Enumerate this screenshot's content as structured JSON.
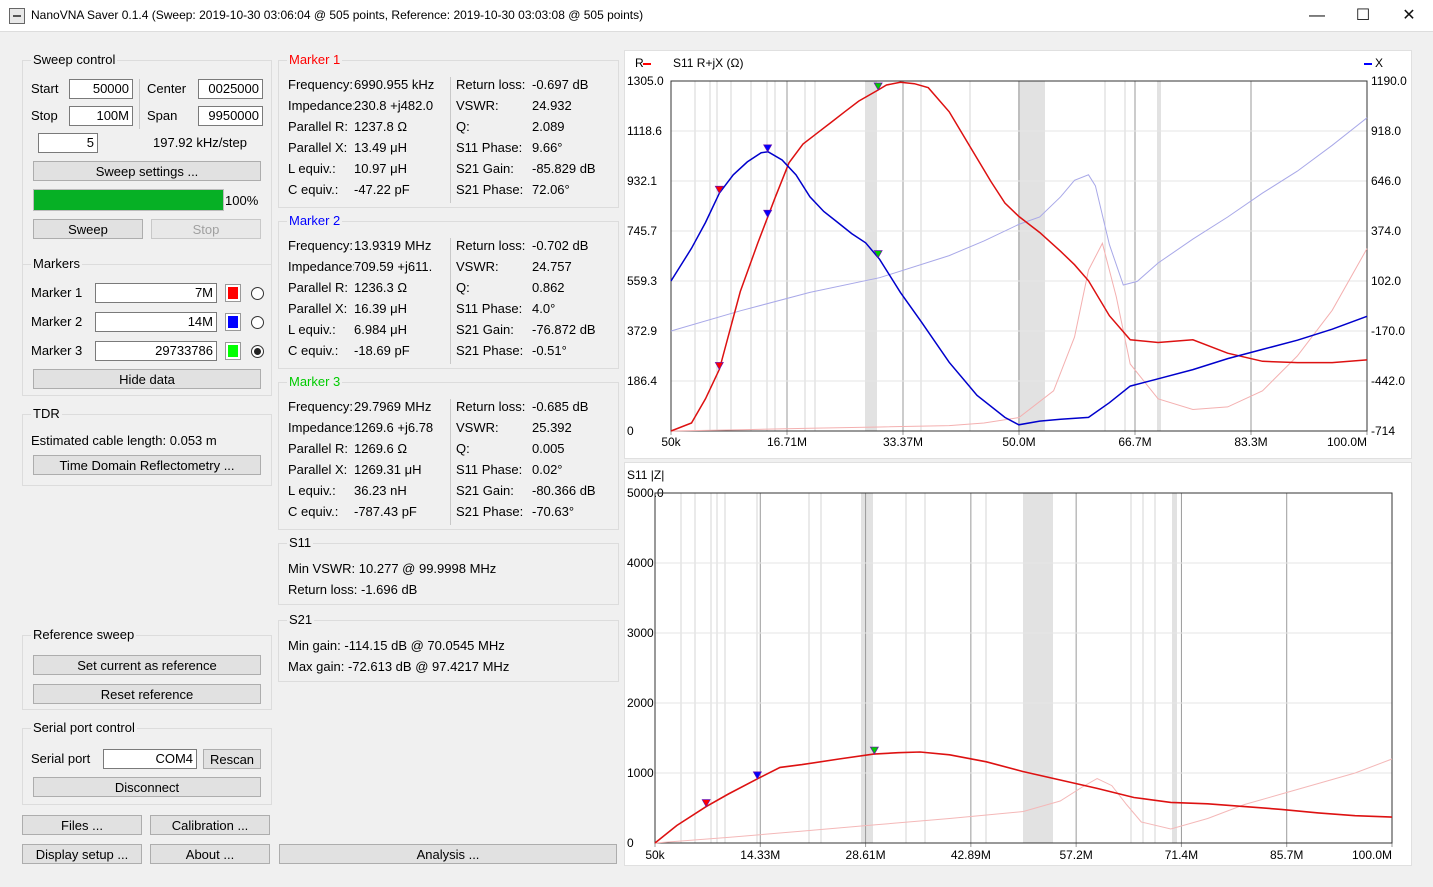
{
  "window": {
    "title": "NanoVNA Saver 0.1.4 (Sweep: 2019-10-30 03:06:04 @ 505 points, Reference: 2019-10-30 03:03:08 @ 505 points)",
    "minimize": "—",
    "maximize": "☐",
    "close": "✕"
  },
  "sweep_control": {
    "title": "Sweep control",
    "start_label": "Start",
    "start_value": "50000",
    "stop_label": "Stop",
    "stop_value": "100M",
    "center_label": "Center",
    "center_value": "0025000",
    "span_label": "Span",
    "span_value": "9950000",
    "segments_value": "5",
    "step_text": "197.92 kHz/step",
    "settings_button": "Sweep settings ...",
    "progress": 100,
    "progress_text": "100%",
    "sweep_button": "Sweep",
    "stop_button": "Stop"
  },
  "markers": {
    "title": "Markers",
    "items": [
      {
        "label": "Marker 1",
        "value": "7M",
        "color": "#ff0000",
        "selected": false
      },
      {
        "label": "Marker 2",
        "value": "14M",
        "color": "#0000ff",
        "selected": false
      },
      {
        "label": "Marker 3",
        "value": "29733786",
        "color": "#00ff00",
        "selected": true
      }
    ],
    "hide_button": "Hide data"
  },
  "tdr": {
    "title": "TDR",
    "text": "Estimated cable length: 0.053 m",
    "button": "Time Domain Reflectometry ..."
  },
  "reference": {
    "title": "Reference sweep",
    "set_button": "Set current as reference",
    "reset_button": "Reset reference"
  },
  "serial": {
    "title": "Serial port control",
    "label": "Serial port",
    "value": "COM4",
    "rescan_button": "Rescan",
    "disconnect_button": "Disconnect"
  },
  "bottom_buttons": {
    "files": "Files ...",
    "calibration": "Calibration ...",
    "display": "Display setup ...",
    "about": "About ...",
    "analysis": "Analysis ..."
  },
  "marker_data": [
    {
      "title": "Marker 1",
      "color": "#ff0000",
      "rows": [
        [
          "Frequency:",
          "6990.955 kHz",
          "Return loss:",
          "-0.697 dB"
        ],
        [
          "Impedance:",
          "230.8 +j482.0",
          "VSWR:",
          "24.932"
        ],
        [
          "Parallel R:",
          "1237.8 Ω",
          "Q:",
          "2.089"
        ],
        [
          "Parallel X:",
          "13.49 μH",
          "S11  Phase:",
          "9.66°"
        ],
        [
          "L equiv.:",
          "10.97 μH",
          "S21  Gain:",
          "-85.829 dB"
        ],
        [
          "C equiv.:",
          "-47.22 pF",
          "S21  Phase:",
          "72.06°"
        ]
      ]
    },
    {
      "title": "Marker 2",
      "color": "#0000ff",
      "rows": [
        [
          "Frequency:",
          "13.9319 MHz",
          "Return loss:",
          "-0.702 dB"
        ],
        [
          "Impedance:",
          "709.59 +j611.",
          "VSWR:",
          "24.757"
        ],
        [
          "Parallel R:",
          "1236.3 Ω",
          "Q:",
          "0.862"
        ],
        [
          "Parallel X:",
          "16.39 μH",
          "S11  Phase:",
          "4.0°"
        ],
        [
          "L equiv.:",
          "6.984 μH",
          "S21  Gain:",
          "-76.872 dB"
        ],
        [
          "C equiv.:",
          "-18.69 pF",
          "S21  Phase:",
          "-0.51°"
        ]
      ]
    },
    {
      "title": "Marker 3",
      "color": "#00cc00",
      "rows": [
        [
          "Frequency:",
          "29.7969 MHz",
          "Return loss:",
          "-0.685 dB"
        ],
        [
          "Impedance:",
          "1269.6 +j6.78",
          "VSWR:",
          "25.392"
        ],
        [
          "Parallel R:",
          "1269.6 Ω",
          "Q:",
          "0.005"
        ],
        [
          "Parallel X:",
          "1269.31 μH",
          "S11  Phase:",
          "0.02°"
        ],
        [
          "L equiv.:",
          "36.23 nH",
          "S21  Gain:",
          "-80.366 dB"
        ],
        [
          "C equiv.:",
          "-787.43 pF",
          "S21  Phase:",
          "-70.63°"
        ]
      ]
    }
  ],
  "s11": {
    "title": "S11",
    "min_vswr": "Min VSWR:   10.277 @ 99.9998 MHz",
    "return_loss": "Return loss: -1.696 dB"
  },
  "s21": {
    "title": "S21",
    "min_gain": "Min gain:  -114.15 dB @ 70.0545 MHz",
    "max_gain": "Max gain: -72.613 dB @ 97.4217 MHz"
  },
  "chart_data": [
    {
      "type": "line",
      "title": "S11  R+jX (Ω)",
      "left_legend": "R",
      "right_legend": "X",
      "xlabel": "",
      "ylabel": "",
      "x_tick_labels": [
        "50k",
        "16.71M",
        "33.37M",
        "50.0M",
        "66.7M",
        "83.3M",
        "100.0M"
      ],
      "y_left_tick_labels": [
        "1305.0",
        "1118.6",
        "932.1",
        "745.7",
        "559.3",
        "372.9",
        "186.4",
        "0"
      ],
      "y_right_tick_labels": [
        "1190.0",
        "918.0",
        "646.0",
        "374.0",
        "102.0",
        "-170.0",
        "-442.0",
        "-714"
      ],
      "xlim": [
        0.05,
        100
      ],
      "ylim_left": [
        0,
        1305
      ],
      "ylim_right": [
        -714,
        1190
      ],
      "grid": true,
      "series": [
        {
          "name": "R",
          "color": "#dd1111",
          "x": [
            0.05,
            3,
            5,
            7,
            10,
            12.5,
            15,
            17,
            19,
            21,
            23,
            25,
            27,
            29.7,
            31,
            33,
            35,
            37,
            40,
            43,
            46,
            48,
            50,
            53,
            56,
            58,
            60,
            63,
            66,
            70,
            75,
            80,
            85,
            90,
            95,
            100
          ],
          "y": [
            0,
            30,
            120,
            230,
            520,
            700,
            870,
            1000,
            1070,
            1110,
            1150,
            1190,
            1230,
            1270,
            1290,
            1300,
            1295,
            1280,
            1190,
            1060,
            930,
            850,
            800,
            740,
            670,
            620,
            560,
            430,
            340,
            330,
            340,
            290,
            260,
            255,
            255,
            265
          ]
        },
        {
          "name": "X",
          "color": "#0000cc",
          "x": [
            0.05,
            3,
            5,
            7,
            9,
            11,
            13,
            14,
            16,
            18,
            20,
            22,
            24,
            26,
            28,
            30,
            33,
            36,
            40,
            44,
            48,
            50,
            53,
            56,
            60,
            63,
            66,
            70,
            75,
            80,
            85,
            90,
            95,
            100
          ],
          "y": [
            102,
            280,
            420,
            580,
            680,
            750,
            800,
            805,
            760,
            680,
            560,
            480,
            420,
            360,
            310,
            220,
            40,
            -120,
            -340,
            -520,
            -640,
            -680,
            -660,
            -650,
            -640,
            -560,
            -470,
            -430,
            -380,
            -320,
            -270,
            -220,
            -160,
            -90
          ]
        },
        {
          "name": "R ref",
          "color": "#f4b0b0",
          "x": [
            0.05,
            10,
            20,
            30,
            40,
            45,
            50,
            55,
            58,
            60,
            62,
            64,
            66,
            70,
            75,
            80,
            85,
            90,
            95,
            100
          ],
          "y": [
            0,
            5,
            10,
            15,
            20,
            30,
            50,
            150,
            350,
            600,
            700,
            500,
            250,
            120,
            80,
            90,
            150,
            280,
            450,
            680
          ]
        },
        {
          "name": "X ref",
          "color": "#a8a8e8",
          "x": [
            0.05,
            10,
            20,
            30,
            40,
            45,
            50,
            53,
            56,
            58,
            60,
            61,
            63,
            65,
            67,
            70,
            75,
            80,
            85,
            90,
            95,
            100
          ],
          "y": [
            -170,
            -60,
            40,
            120,
            240,
            320,
            410,
            450,
            560,
            650,
            680,
            620,
            300,
            80,
            100,
            200,
            330,
            450,
            580,
            700,
            840,
            990
          ]
        }
      ],
      "markers": [
        {
          "label": "1",
          "x": 6.99,
          "series": "R",
          "color": "#ff0000"
        },
        {
          "label": "1",
          "x": 6.99,
          "series": "X",
          "color": "#ff0000"
        },
        {
          "label": "2",
          "x": 13.93,
          "series": "R",
          "color": "#0000ff"
        },
        {
          "label": "2",
          "x": 13.93,
          "series": "X",
          "color": "#0000ff"
        },
        {
          "label": "3",
          "x": 29.8,
          "series": "R",
          "color": "#00cc00"
        },
        {
          "label": "3",
          "x": 29.8,
          "series": "X",
          "color": "#00cc00"
        }
      ]
    },
    {
      "type": "line",
      "title": "S11 |Z|",
      "xlabel": "",
      "ylabel": "",
      "x_tick_labels": [
        "50k",
        "14.33M",
        "28.61M",
        "42.89M",
        "57.2M",
        "71.4M",
        "85.7M",
        "100.0M"
      ],
      "y_tick_labels": [
        "5000.0",
        "4000",
        "3000",
        "2000",
        "1000",
        "0"
      ],
      "xlim": [
        0.05,
        100
      ],
      "ylim": [
        0,
        5000
      ],
      "grid": true,
      "series": [
        {
          "name": "|Z|",
          "color": "#dd1111",
          "x": [
            0.05,
            3,
            7,
            10,
            14,
            17,
            20,
            25,
            29.7,
            33,
            36,
            40,
            45,
            50,
            55,
            60,
            65,
            70,
            75,
            80,
            85,
            90,
            95,
            100
          ],
          "y": [
            0,
            250,
            520,
            700,
            920,
            1080,
            1120,
            1200,
            1270,
            1290,
            1300,
            1260,
            1160,
            1020,
            900,
            780,
            650,
            580,
            560,
            520,
            480,
            430,
            390,
            370
          ]
        },
        {
          "name": "|Z| ref",
          "color": "#f4b8b8",
          "x": [
            0.05,
            10,
            20,
            30,
            40,
            50,
            55,
            58,
            60,
            62,
            64,
            66,
            70,
            75,
            80,
            85,
            90,
            95,
            100
          ],
          "y": [
            0,
            80,
            170,
            260,
            350,
            450,
            600,
            800,
            920,
            820,
            550,
            300,
            200,
            350,
            550,
            700,
            850,
            1000,
            1200
          ]
        }
      ],
      "markers": [
        {
          "label": "1",
          "x": 6.99,
          "color": "#ff0000"
        },
        {
          "label": "2",
          "x": 13.93,
          "color": "#0000ff"
        },
        {
          "label": "3",
          "x": 29.8,
          "color": "#00cc00"
        }
      ]
    }
  ]
}
